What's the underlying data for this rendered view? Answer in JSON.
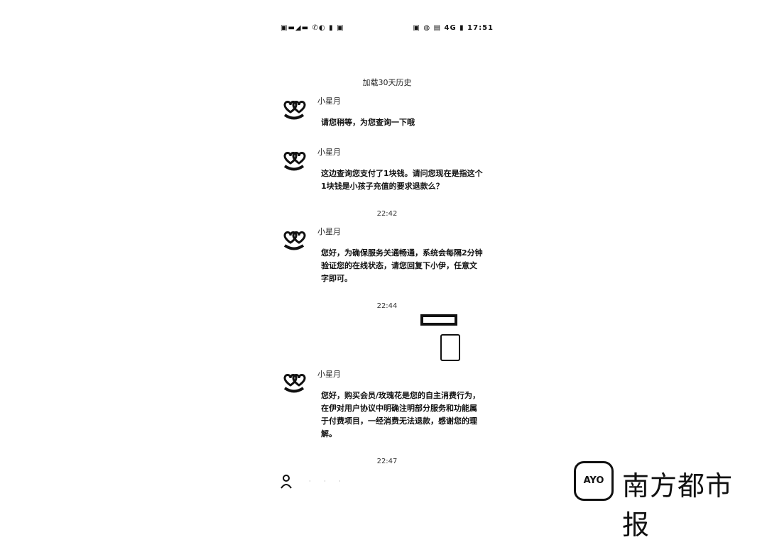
{
  "status_bar": {
    "left": "▣▬◢▬ ✆◐ ▮ ▣",
    "right": "▣ ◍ ▤ 4G ▮ 17:51"
  },
  "history_link": "加载30天历史",
  "messages": [
    {
      "sender": "小星月",
      "text": "请您稍等，为您查询一下哦"
    },
    {
      "sender": "小星月",
      "text": "这边查询您支付了1块钱。请问您现在是指这个1块钱是小孩子充值的要求退款么？"
    },
    {
      "sender": "小星月",
      "text": "您好，为确保服务关通畅通，系统会每隔2分钟验证您的在线状态，请您回复下小伊，任意文字即可。"
    },
    {
      "sender": "小星月",
      "text": "您好，购买会员/玫瑰花是您的自主消费行为，在伊对用户协议中明确注明部分服务和功能属于付费项目，一经消费无法退款，感谢您的理解。"
    }
  ],
  "timestamps": [
    "22:42",
    "22:44",
    "22:47"
  ],
  "watermark": {
    "logo_text": "AYO",
    "text": "南方都市报"
  }
}
